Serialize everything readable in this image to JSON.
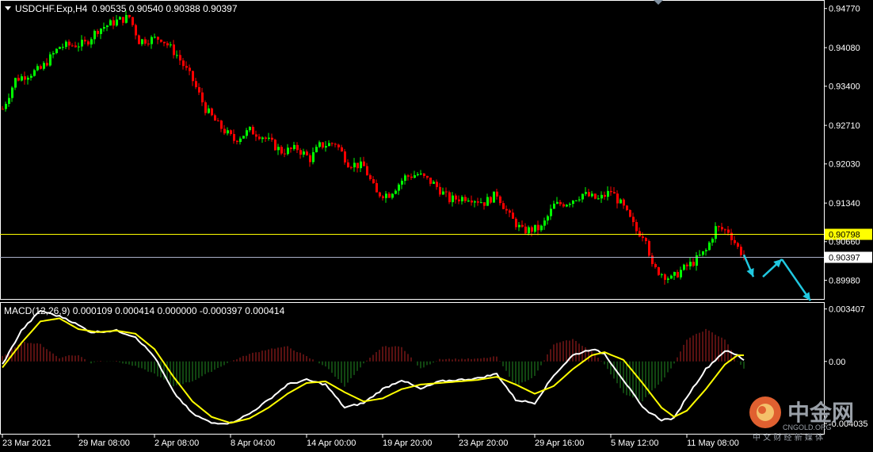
{
  "window": {
    "symbol_label": "USDCHF.Exp,H4",
    "ohlc": "0.90535 0.90540 0.90388 0.90397",
    "menu_icon": "triangle-down-icon"
  },
  "indicator": {
    "label": "MACD(12,26,9) 0.000109 0.000414 0.000000 -0.000397 0.000414"
  },
  "colors": {
    "background": "#000000",
    "bull": "#00ff00",
    "bear": "#ff0000",
    "grid": "#ffffff",
    "hline": "#ffff00",
    "bid_line": "#aab0c8",
    "macd_line": "#ffffff",
    "signal_line": "#ffff00",
    "hist_pos": "#b22222",
    "hist_neg": "#228b22",
    "arrow": "#20c8e0"
  },
  "watermark": {
    "brand": "中金网",
    "domain": "CNGOLD.ORG",
    "tagline": "中 文 财 经 新 媒 体",
    "logo_icon": "cngold-logo-icon"
  },
  "chart_data": [
    {
      "type": "candlestick",
      "title": "USDCHF.Exp,H4",
      "ylim": [
        0.8965,
        0.9492
      ],
      "y_ticks": [
        "0.94770",
        "0.94080",
        "0.93400",
        "0.92710",
        "0.92030",
        "0.91340",
        "0.90660",
        "0.89980"
      ],
      "y_tick_values": [
        0.9477,
        0.9408,
        0.934,
        0.9271,
        0.9203,
        0.9134,
        0.9066,
        0.8998
      ],
      "x_ticks": [
        "23 Mar 2021",
        "29 Mar 08:00",
        "2 Apr 08:00",
        "8 Apr 04:00",
        "14 Apr 00:00",
        "19 Apr 20:00",
        "23 Apr 20:00",
        "29 Apr 16:00",
        "5 May 12:00",
        "11 May 08:00"
      ],
      "x_tick_bars": [
        0,
        24,
        48,
        72,
        96,
        120,
        144,
        168,
        192,
        216
      ],
      "horizontal_lines": [
        {
          "price": 0.90798,
          "label": "0.90798",
          "style": "yellow"
        },
        {
          "price": 0.90397,
          "label": "0.90397",
          "style": "bid"
        }
      ],
      "anchors": [
        [
          0,
          0.93
        ],
        [
          4,
          0.9352
        ],
        [
          12,
          0.937
        ],
        [
          18,
          0.941
        ],
        [
          26,
          0.9415
        ],
        [
          30,
          0.944
        ],
        [
          36,
          0.9455
        ],
        [
          40,
          0.9462
        ],
        [
          43,
          0.942
        ],
        [
          50,
          0.9425
        ],
        [
          55,
          0.9395
        ],
        [
          60,
          0.935
        ],
        [
          64,
          0.93
        ],
        [
          68,
          0.9272
        ],
        [
          73,
          0.9245
        ],
        [
          78,
          0.9262
        ],
        [
          82,
          0.9252
        ],
        [
          88,
          0.9225
        ],
        [
          93,
          0.923
        ],
        [
          97,
          0.9212
        ],
        [
          100,
          0.9235
        ],
        [
          105,
          0.924
        ],
        [
          109,
          0.9205
        ],
        [
          114,
          0.9198
        ],
        [
          118,
          0.915
        ],
        [
          122,
          0.915
        ],
        [
          127,
          0.918
        ],
        [
          131,
          0.9185
        ],
        [
          136,
          0.9168
        ],
        [
          141,
          0.914
        ],
        [
          147,
          0.9145
        ],
        [
          152,
          0.9135
        ],
        [
          156,
          0.915
        ],
        [
          160,
          0.911
        ],
        [
          164,
          0.9085
        ],
        [
          170,
          0.909
        ],
        [
          174,
          0.913
        ],
        [
          178,
          0.9135
        ],
        [
          183,
          0.915
        ],
        [
          188,
          0.914
        ],
        [
          192,
          0.9155
        ],
        [
          196,
          0.9125
        ],
        [
          200,
          0.9085
        ],
        [
          203,
          0.9075
        ],
        [
          205,
          0.902
        ],
        [
          208,
          0.901
        ],
        [
          211,
          0.9
        ],
        [
          214,
          0.9015
        ],
        [
          218,
          0.903
        ],
        [
          222,
          0.905
        ],
        [
          225,
          0.909
        ],
        [
          229,
          0.9085
        ],
        [
          232,
          0.9055
        ],
        [
          234,
          0.904
        ]
      ],
      "projection_arrows": [
        [
          [
            234,
            0.9043
          ],
          [
            237,
            0.9004
          ]
        ],
        [
          [
            240,
            0.9004
          ],
          [
            246,
            0.9035
          ]
        ],
        [
          [
            246,
            0.9035
          ],
          [
            255,
            0.8962
          ]
        ]
      ]
    },
    {
      "type": "macd",
      "params": "12,26,9",
      "ylim": [
        -0.00475,
        0.0038
      ],
      "y_ticks": [
        "0.003407",
        "0.00",
        "-0.004035"
      ],
      "y_tick_values": [
        0.003407,
        0.0,
        -0.004035
      ],
      "series": [
        {
          "name": "MACD",
          "anchors": [
            [
              0,
              -0.0002
            ],
            [
              6,
              0.002
            ],
            [
              12,
              0.0033
            ],
            [
              20,
              0.0028
            ],
            [
              28,
              0.0019
            ],
            [
              36,
              0.002
            ],
            [
              42,
              0.0016
            ],
            [
              48,
              0.0003
            ],
            [
              54,
              -0.002
            ],
            [
              60,
              -0.0034
            ],
            [
              66,
              -0.004
            ],
            [
              72,
              -0.004
            ],
            [
              78,
              -0.0034
            ],
            [
              84,
              -0.0025
            ],
            [
              90,
              -0.0015
            ],
            [
              96,
              -0.0012
            ],
            [
              102,
              -0.0015
            ],
            [
              108,
              -0.003
            ],
            [
              114,
              -0.0027
            ],
            [
              120,
              -0.0018
            ],
            [
              126,
              -0.0012
            ],
            [
              132,
              -0.0018
            ],
            [
              138,
              -0.0013
            ],
            [
              144,
              -0.0012
            ],
            [
              150,
              -0.0011
            ],
            [
              156,
              -0.0008
            ],
            [
              162,
              -0.0025
            ],
            [
              168,
              -0.0027
            ],
            [
              174,
              -0.0009
            ],
            [
              180,
              0.0004
            ],
            [
              186,
              0.0008
            ],
            [
              190,
              0.0005
            ],
            [
              196,
              -0.0012
            ],
            [
              202,
              -0.003
            ],
            [
              208,
              -0.0038
            ],
            [
              212,
              -0.0037
            ],
            [
              216,
              -0.0023
            ],
            [
              222,
              -0.0005
            ],
            [
              228,
              0.0007
            ],
            [
              232,
              0.0004
            ],
            [
              234,
              0.0001
            ]
          ]
        },
        {
          "name": "Signal",
          "anchors": [
            [
              0,
              -0.0004
            ],
            [
              6,
              0.0012
            ],
            [
              12,
              0.0026
            ],
            [
              18,
              0.0028
            ],
            [
              24,
              0.0021
            ],
            [
              30,
              0.0019
            ],
            [
              36,
              0.002
            ],
            [
              42,
              0.0018
            ],
            [
              48,
              0.0008
            ],
            [
              54,
              -0.001
            ],
            [
              60,
              -0.0026
            ],
            [
              66,
              -0.0036
            ],
            [
              72,
              -0.004
            ],
            [
              78,
              -0.0037
            ],
            [
              84,
              -0.003
            ],
            [
              90,
              -0.0021
            ],
            [
              96,
              -0.0014
            ],
            [
              102,
              -0.0013
            ],
            [
              108,
              -0.002
            ],
            [
              114,
              -0.0026
            ],
            [
              120,
              -0.0024
            ],
            [
              126,
              -0.0018
            ],
            [
              132,
              -0.0015
            ],
            [
              138,
              -0.0014
            ],
            [
              144,
              -0.0013
            ],
            [
              150,
              -0.0012
            ],
            [
              156,
              -0.001
            ],
            [
              162,
              -0.0015
            ],
            [
              168,
              -0.0021
            ],
            [
              174,
              -0.0016
            ],
            [
              180,
              -0.0005
            ],
            [
              186,
              0.0004
            ],
            [
              190,
              0.0006
            ],
            [
              196,
              0.0001
            ],
            [
              202,
              -0.0014
            ],
            [
              208,
              -0.003
            ],
            [
              212,
              -0.0036
            ],
            [
              216,
              -0.0032
            ],
            [
              222,
              -0.0018
            ],
            [
              228,
              -0.0002
            ],
            [
              232,
              0.0004
            ],
            [
              234,
              0.0004
            ]
          ]
        }
      ]
    }
  ]
}
